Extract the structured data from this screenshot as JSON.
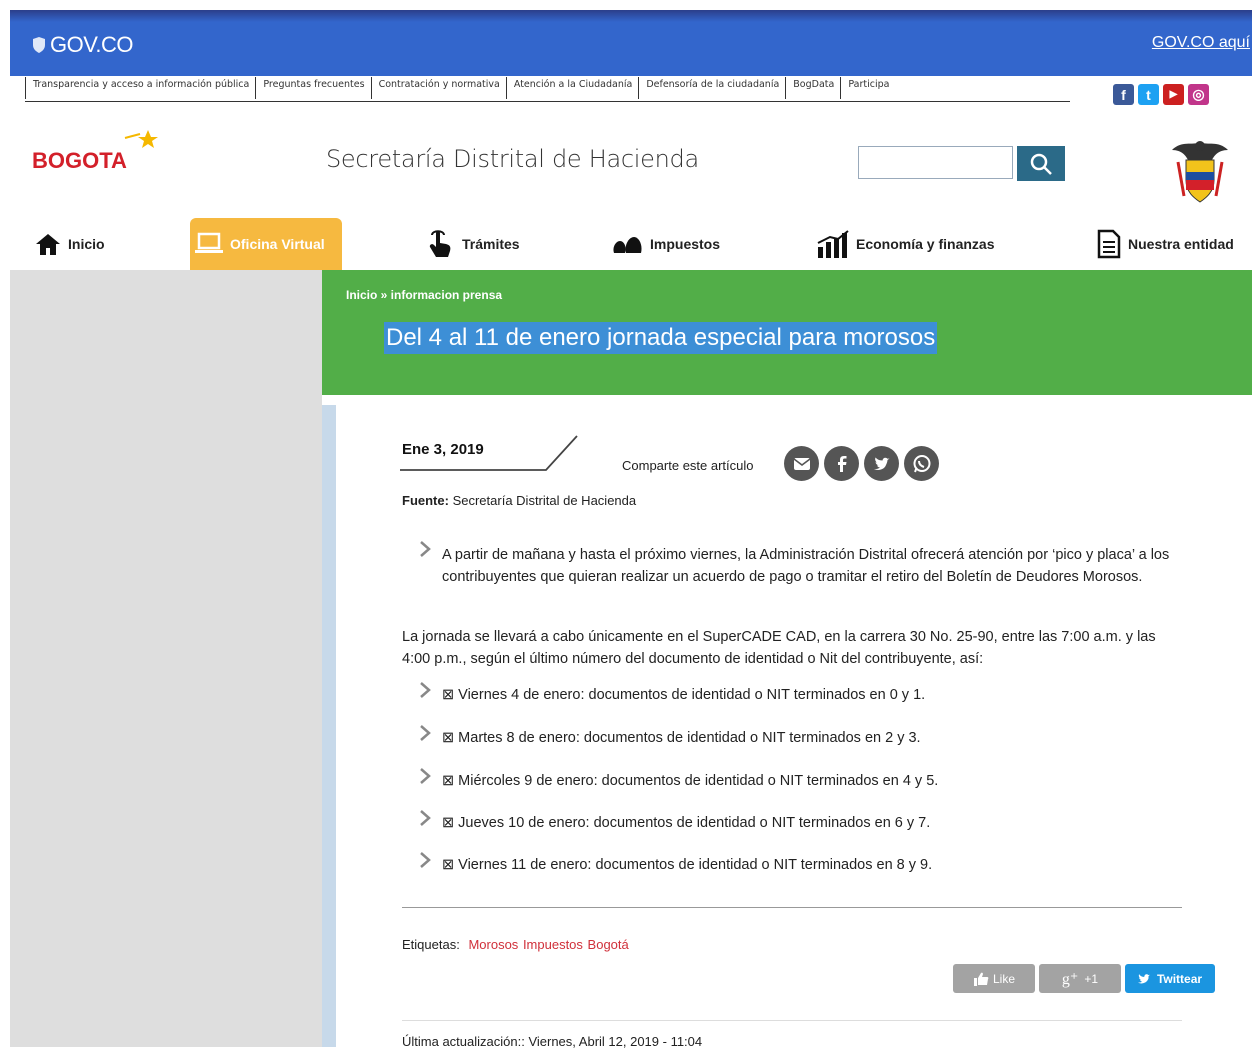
{
  "gov": {
    "logo": "GOV.CO",
    "link": "GOV.CO aquí"
  },
  "toplinks": [
    "Transparencia y acceso a información pública",
    "Preguntas frecuentes",
    "Contratación y normativa",
    "Atención a la Ciudadanía",
    "Defensoría de la ciudadanía",
    "BogData",
    "Participa"
  ],
  "social": [
    {
      "icon": "facebook-icon",
      "glyph": "f",
      "color": "#3b5998"
    },
    {
      "icon": "twitter-icon",
      "glyph": "t",
      "color": "#1da1f2"
    },
    {
      "icon": "youtube-icon",
      "glyph": "▶",
      "color": "#cc2020"
    },
    {
      "icon": "instagram-icon",
      "glyph": "◎",
      "color": "#c1358a"
    }
  ],
  "header": {
    "logo_text": "BOGOTA",
    "site_title": "Secretaría Distrital de Hacienda",
    "search_value": ""
  },
  "nav": {
    "inicio": "Inicio",
    "oficina": "Oficina Virtual",
    "tramites": "Trámites",
    "impuestos": "Impuestos",
    "economia": "Economía y finanzas",
    "entidad": "Nuestra entidad"
  },
  "breadcrumb": "Inicio » informacion prensa",
  "article": {
    "title": "Del 4 al 11 de enero jornada especial para morosos",
    "date": "Ene 3, 2019",
    "share_label": "Comparte este artículo",
    "fuente_label": "Fuente:",
    "fuente_value": "Secretaría Distrital de Hacienda",
    "lead": "A partir de mañana y hasta el próximo viernes, la Administración Distrital ofrecerá atención por ‘pico y placa’ a los contribuyentes que quieran realizar un acuerdo de pago o tramitar el retiro del Boletín de Deudores Morosos.",
    "body": "La jornada se llevará a cabo únicamente en el SuperCADE CAD, en la carrera 30 No. 25-90, entre las 7:00 a.m. y las 4:00 p.m., según el último número del documento de identidad o Nit del contribuyente, así:",
    "items": [
      "⊠ Viernes 4 de enero: documentos de identidad o NIT terminados en 0 y 1.",
      "⊠ Martes 8 de enero: documentos de identidad o NIT terminados en 2 y 3.",
      "⊠ Miércoles 9 de enero: documentos de identidad o NIT terminados en 4 y 5.",
      "⊠ Jueves 10 de enero: documentos de identidad o NIT terminados en 6 y 7.",
      "⊠ Viernes 11 de enero: documentos de identidad o NIT terminados en 8 y 9."
    ],
    "tags_label": "Etiquetas:",
    "tags": [
      "Morosos",
      "Impuestos",
      "Bogotá"
    ],
    "buttons": {
      "like": "Like",
      "gplus": "+1",
      "tweet": "Twittear"
    },
    "updated": "Última actualización:: Viernes, Abril 12, 2019 - 11:04"
  }
}
